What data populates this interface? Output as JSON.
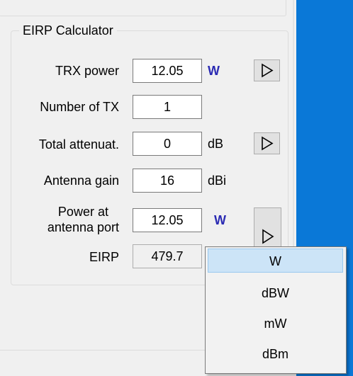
{
  "group": {
    "title": "EIRP Calculator"
  },
  "rows": {
    "trx_power": {
      "label": "TRX power",
      "value": "12.05",
      "unit": "W"
    },
    "num_tx": {
      "label": "Number of TX",
      "value": "1"
    },
    "total_att": {
      "label": "Total attenuat.",
      "value": "0",
      "unit": "dB"
    },
    "ant_gain": {
      "label": "Antenna gain",
      "value": "16",
      "unit": "dBi"
    },
    "power_port": {
      "label_line1": "Power at",
      "label_line2": "antenna port",
      "value": "12.05",
      "unit": "W"
    },
    "eirp": {
      "label": "EIRP",
      "value": "479.7"
    }
  },
  "dropdown": {
    "items": [
      "W",
      "dBW",
      "mW",
      "dBm"
    ],
    "selected": "W"
  },
  "colors": {
    "unit_accent": "#2b2bb3",
    "desktop_blue": "#0a78d7",
    "selection": "#cce4f7"
  },
  "icons": {
    "arrow": "play-triangle-icon"
  }
}
